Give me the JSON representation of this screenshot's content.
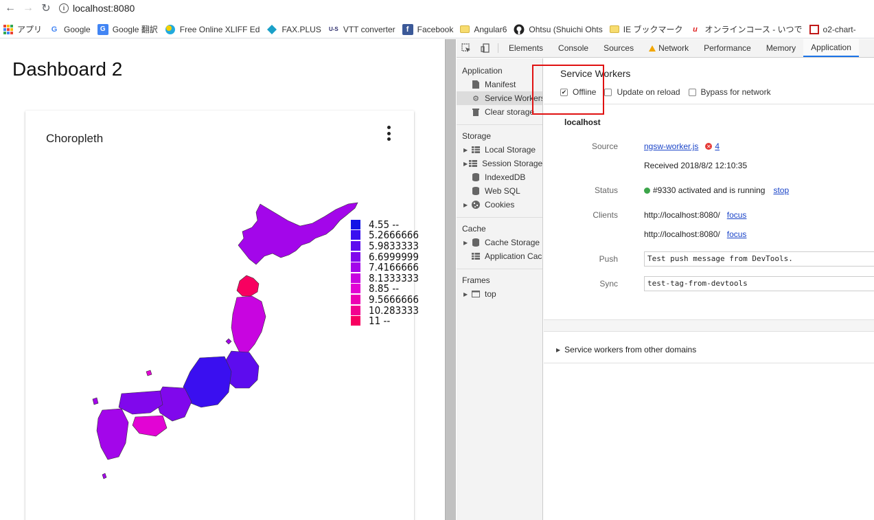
{
  "browser": {
    "url": "localhost:8080",
    "bookmarks": [
      {
        "label": "アプリ",
        "icon": "apps-grid-icon"
      },
      {
        "label": "Google",
        "icon": "google-icon",
        "color": "#4285f4"
      },
      {
        "label": "Google 翻訳",
        "icon": "translate-icon",
        "color": "#4285f4"
      },
      {
        "label": "Free Online XLIFF Ed",
        "icon": "xliff-icon",
        "color": "#22aadd"
      },
      {
        "label": "FAX.PLUS",
        "icon": "fax-icon",
        "color": "#1aa0c8"
      },
      {
        "label": "VTT converter",
        "icon": "vtt-icon",
        "color": "#2a2a6a"
      },
      {
        "label": "Facebook",
        "icon": "facebook-icon",
        "color": "#3b5998"
      },
      {
        "label": "Angular6",
        "icon": "folder-icon"
      },
      {
        "label": "Ohtsu (Shuichi Ohts",
        "icon": "github-icon",
        "color": "#222"
      },
      {
        "label": "IE ブックマーク",
        "icon": "folder-icon"
      },
      {
        "label": "オンラインコース - いつで",
        "icon": "udemy-icon",
        "color": "#e02020"
      },
      {
        "label": "o2-chart-",
        "icon": "bookmark-red-icon",
        "color": "#c01818"
      }
    ]
  },
  "page": {
    "title": "Dashboard 2",
    "card_title": "Choropleth"
  },
  "chart_data": {
    "type": "choropleth",
    "legend": [
      {
        "label": "4.55 --",
        "color": "#1414e6"
      },
      {
        "label": "5.2666666",
        "color": "#3a0ff0"
      },
      {
        "label": "5.9833333",
        "color": "#5d0cee"
      },
      {
        "label": "6.6999999",
        "color": "#8008ec"
      },
      {
        "label": "7.4166666",
        "color": "#a306ea"
      },
      {
        "label": "8.1333333",
        "color": "#c805e0"
      },
      {
        "label": "8.85 --",
        "color": "#e204d4"
      },
      {
        "label": "9.5666666",
        "color": "#ec02b4"
      },
      {
        "label": "10.283333",
        "color": "#f20390"
      },
      {
        "label": "11 --",
        "color": "#f80060"
      }
    ]
  },
  "devtools": {
    "tabs": [
      "Elements",
      "Console",
      "Sources",
      "Network",
      "Performance",
      "Memory",
      "Application"
    ],
    "active_tab": "Application",
    "sidebar": {
      "application_header": "Application",
      "application_items": [
        "Manifest",
        "Service Workers",
        "Clear storage"
      ],
      "storage_header": "Storage",
      "storage_items": [
        "Local Storage",
        "Session Storage",
        "IndexedDB",
        "Web SQL",
        "Cookies"
      ],
      "cache_header": "Cache",
      "cache_items": [
        "Cache Storage",
        "Application Cac"
      ],
      "frames_header": "Frames",
      "frames_items": [
        "top"
      ]
    },
    "service_workers": {
      "title": "Service Workers",
      "offline_label": "Offline",
      "offline_checked": true,
      "update_on_reload_label": "Update on reload",
      "bypass_label": "Bypass for network",
      "origin": "localhost",
      "source_label": "Source",
      "source_file": "ngsw-worker.js",
      "error_count": "4",
      "received": "Received 2018/8/2 12:10:35",
      "status_label": "Status",
      "status_text": "#9330 activated and is running",
      "stop_label": "stop",
      "clients_label": "Clients",
      "clients": [
        "http://localhost:8080/",
        "http://localhost:8080/"
      ],
      "focus_label": "focus",
      "push_label": "Push",
      "push_value": "Test push message from DevTools.",
      "sync_label": "Sync",
      "sync_value": "test-tag-from-devtools",
      "other_domains_label": "Service workers from other domains"
    }
  }
}
